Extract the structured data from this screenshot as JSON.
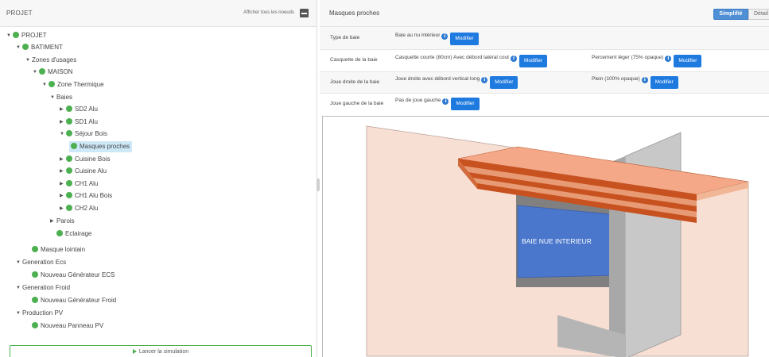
{
  "left": {
    "title": "PROJET",
    "show_nodes": "Afficher tous les noeuds",
    "tree": {
      "projet": "PROJET",
      "batiment": "BATIMENT",
      "zones": "Zones d'usages",
      "maison": "MAISON",
      "zone_thermique": "Zone Thermique",
      "baies": "Baies",
      "sd2": "SD2 Alu",
      "sd1": "SD1 Alu",
      "sejour": "Séjour Bois",
      "masques_proches": "Masques proches",
      "cuisine_bois": "Cuisine Bois",
      "cuisine_alu": "Cuisine Alu",
      "ch1_alu": "CH1 Alu",
      "ch1_alu_bois": "CH1 Alu Bois",
      "ch2_alu": "CH2 Alu",
      "parois": "Parois",
      "eclairage": "Eclairage",
      "masque_lointain": "Masque lointain",
      "generation_ecs": "Generation Ecs",
      "nouveau_gen_ecs": "Nouveau Générateur ECS",
      "generation_froid": "Generation Froid",
      "nouveau_gen_froid": "Nouveau Générateur Froid",
      "production_pv": "Production PV",
      "nouveau_panneau_pv": "Nouveau Panneau PV"
    },
    "simulation_button": "Lancer la simulation"
  },
  "right": {
    "title": "Masques proches",
    "tabs": {
      "simplifie": "Simplifié",
      "detail": "Détail"
    },
    "rows": {
      "type_baie": {
        "label": "Type de baie",
        "value": "Baie au nu intérieur"
      },
      "casquette": {
        "label": "Casquette de la baie",
        "value": "Casquette courte (80cm) Avec débord latéral cout",
        "value2": "Percement léger (75% opaque)"
      },
      "joue_droite": {
        "label": "Joue droite de la baie",
        "value": "Joue droite avec débord vertical long",
        "value2": "Plein (100% opaque)"
      },
      "joue_gauche": {
        "label": "Joue gauche de la baie",
        "value": "Pas de joue gauche"
      }
    },
    "modifier_label": "Modifier",
    "scene_label": "BAIE NUE INTERIEUR"
  },
  "colors": {
    "accent_blue": "#1f7ae0",
    "tree_dot_green": "#4cb050",
    "wall_pink": "#f8dfd4",
    "overhang_orange": "#c8521f",
    "window_blue": "#4a76cc"
  }
}
